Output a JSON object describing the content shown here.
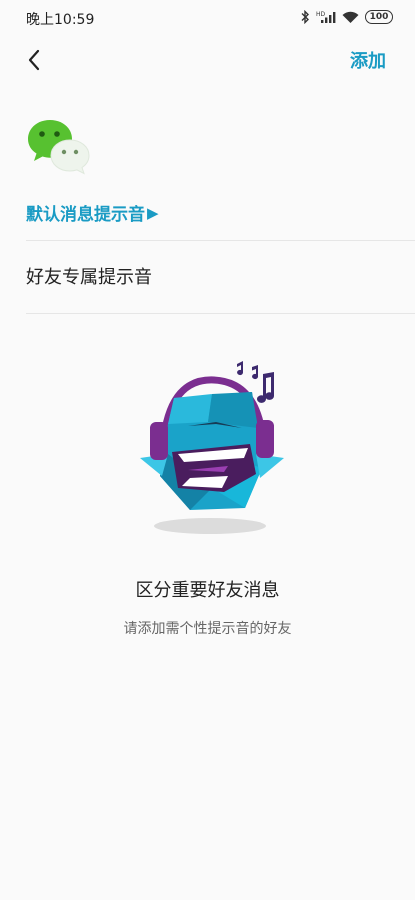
{
  "status_bar": {
    "time": "晚上10:59",
    "battery": "100",
    "icons": [
      "bluetooth-icon",
      "signal-icon",
      "wifi-icon",
      "battery-icon"
    ]
  },
  "nav": {
    "back_icon": "chevron-left-icon",
    "add_label": "添加"
  },
  "default_tone": {
    "label": "默认消息提示音",
    "arrow": "▶",
    "app_icon": "wechat-icon"
  },
  "section": {
    "title": "好友专属提示音"
  },
  "empty_state": {
    "illustration": "headphones-monster-illustration",
    "title": "区分重要好友消息",
    "subtitle": "请添加需个性提示音的好友"
  },
  "colors": {
    "accent": "#1a9bc4",
    "wechat_green": "#57c130"
  }
}
